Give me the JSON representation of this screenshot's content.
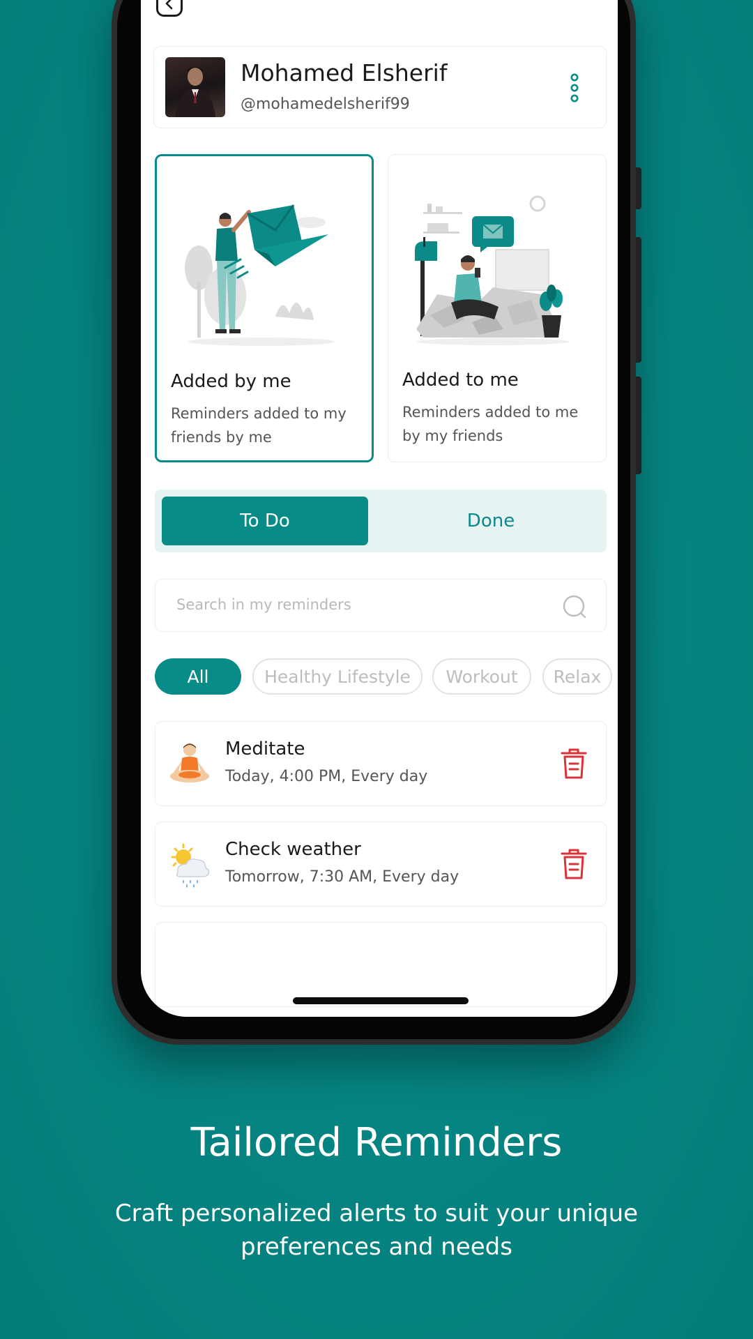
{
  "profile": {
    "name": "Mohamed Elsherif",
    "handle": "@mohamedelsherif99"
  },
  "modes": [
    {
      "title": "Added by me",
      "description": "Reminders added to my friends by me",
      "selected": true
    },
    {
      "title": "Added to me",
      "description": "Reminders added to me by my friends",
      "selected": false
    }
  ],
  "status_tabs": {
    "todo": "To Do",
    "done": "Done",
    "selected": "todo"
  },
  "search": {
    "placeholder": "Search in my reminders"
  },
  "categories": [
    "All",
    "Healthy Lifestyle",
    "Workout",
    "Relax"
  ],
  "selected_category": "All",
  "reminders": [
    {
      "title": "Meditate",
      "schedule": "Today, 4:00 PM, Every day",
      "icon": "meditation-emoji"
    },
    {
      "title": "Check weather",
      "schedule": "Tomorrow, 7:30 AM, Every day",
      "icon": "weather-emoji"
    }
  ],
  "promo": {
    "headline": "Tailored Reminders",
    "subline": "Craft personalized alerts to suit your unique preferences and needs"
  },
  "colors": {
    "accent": "#098b88",
    "background": "#068583",
    "delete": "#d9333a"
  }
}
